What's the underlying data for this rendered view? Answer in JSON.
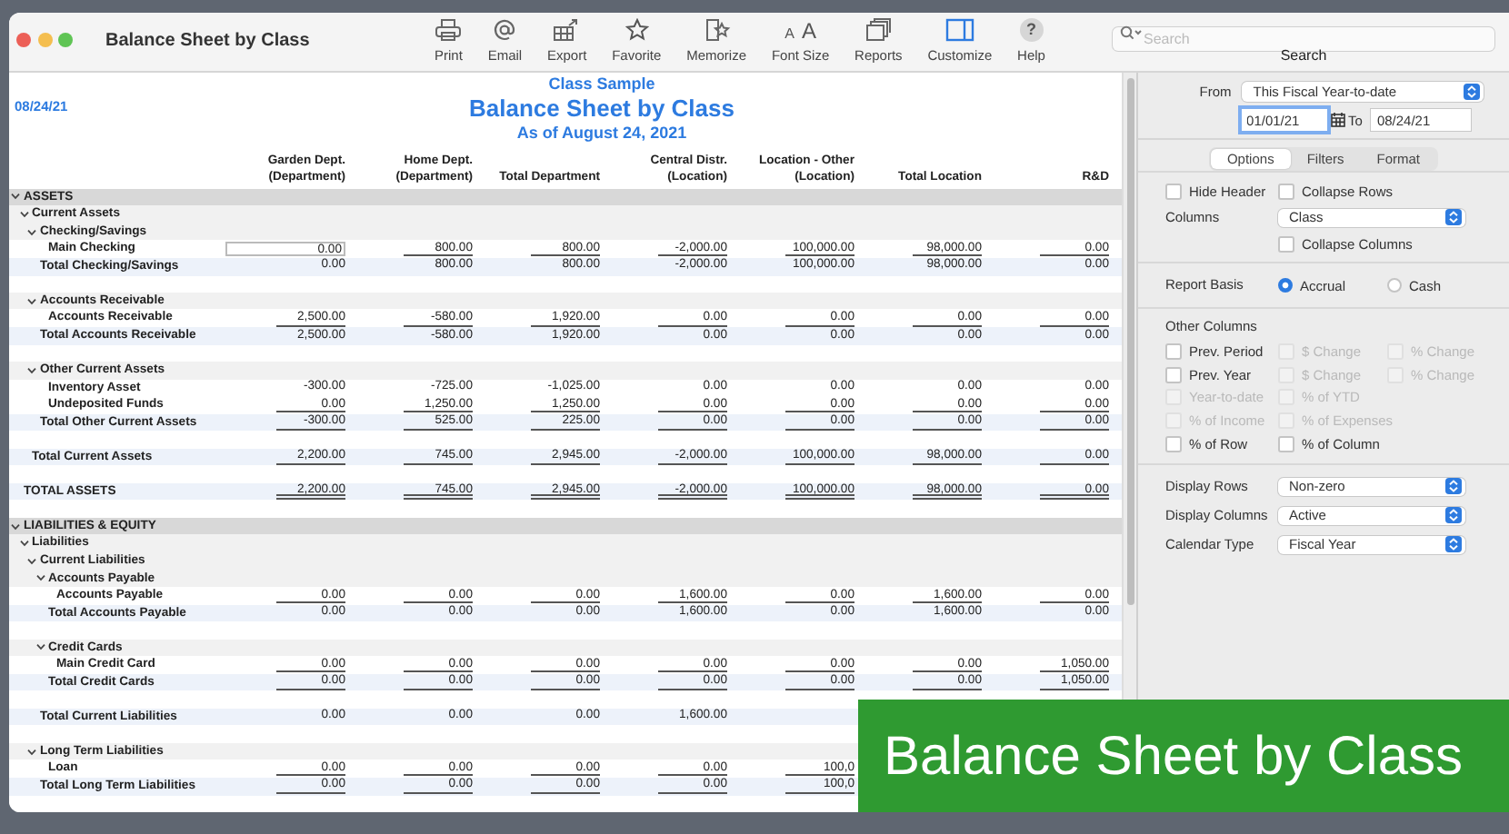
{
  "window": {
    "title": "Balance Sheet by Class"
  },
  "toolbar": [
    {
      "kind": "print",
      "label": "Print"
    },
    {
      "kind": "email",
      "label": "Email"
    },
    {
      "kind": "export",
      "label": "Export"
    },
    {
      "kind": "favorite",
      "label": "Favorite"
    },
    {
      "kind": "memorize",
      "label": "Memorize"
    },
    {
      "kind": "font_size",
      "label": "Font Size",
      "glyphs": [
        "A",
        "A"
      ]
    },
    {
      "kind": "reports",
      "label": "Reports"
    },
    {
      "kind": "customize",
      "label": "Customize"
    },
    {
      "kind": "help",
      "label": "Help",
      "glyphs": [
        "?"
      ]
    }
  ],
  "search": {
    "placeholder": "Search",
    "label": "Search"
  },
  "report": {
    "date": "08/24/21",
    "company": "Class Sample",
    "title": "Balance Sheet by Class",
    "subtitle": "As of August 24, 2021",
    "columns": [
      {
        "line1": "Garden Dept.",
        "line2": "(Department)"
      },
      {
        "line1": "Home Dept.",
        "line2": "(Department)"
      },
      {
        "line2": "Total Department"
      },
      {
        "line1": "Central Distr.",
        "line2": "(Location)"
      },
      {
        "line1": "Location - Other",
        "line2": "(Location)"
      },
      {
        "line2": "Total Location"
      },
      {
        "line2": "R&D"
      }
    ],
    "rows": [
      {
        "kind": "section",
        "label": "ASSETS",
        "expanded": true,
        "children": [
          {
            "kind": "group",
            "label": "Current Assets",
            "expanded": true,
            "children": [
              {
                "kind": "group",
                "label": "Checking/Savings",
                "expanded": true,
                "children": [
                  {
                    "kind": "row",
                    "label": "Main Checking",
                    "editing": true,
                    "underline": true,
                    "cells": [
                      "0.00",
                      "800.00",
                      "800.00",
                      "-2,000.00",
                      "100,000.00",
                      "98,000.00",
                      "0.00"
                    ]
                  }
                ],
                "total": {
                  "label": "Total Checking/Savings",
                  "underline": false,
                  "cells": [
                    "0.00",
                    "800.00",
                    "800.00",
                    "-2,000.00",
                    "100,000.00",
                    "98,000.00",
                    "0.00"
                  ]
                }
              },
              {
                "kind": "group",
                "label": "Accounts Receivable",
                "expanded": true,
                "children": [
                  {
                    "kind": "row",
                    "label": "Accounts Receivable",
                    "underline": true,
                    "cells": [
                      "2,500.00",
                      "-580.00",
                      "1,920.00",
                      "0.00",
                      "0.00",
                      "0.00",
                      "0.00"
                    ]
                  }
                ],
                "total": {
                  "label": "Total Accounts Receivable",
                  "underline": false,
                  "cells": [
                    "2,500.00",
                    "-580.00",
                    "1,920.00",
                    "0.00",
                    "0.00",
                    "0.00",
                    "0.00"
                  ]
                }
              },
              {
                "kind": "group",
                "label": "Other Current Assets",
                "expanded": true,
                "children": [
                  {
                    "kind": "row",
                    "label": "Inventory Asset",
                    "underline": false,
                    "cells": [
                      "-300.00",
                      "-725.00",
                      "-1,025.00",
                      "0.00",
                      "0.00",
                      "0.00",
                      "0.00"
                    ]
                  },
                  {
                    "kind": "row",
                    "label": "Undeposited Funds",
                    "underline": true,
                    "cells": [
                      "0.00",
                      "1,250.00",
                      "1,250.00",
                      "0.00",
                      "0.00",
                      "0.00",
                      "0.00"
                    ]
                  }
                ],
                "total": {
                  "label": "Total Other Current Assets",
                  "underline": true,
                  "cells": [
                    "-300.00",
                    "525.00",
                    "225.00",
                    "0.00",
                    "0.00",
                    "0.00",
                    "0.00"
                  ]
                }
              }
            ],
            "total": {
              "label": "Total Current Assets",
              "underline": true,
              "double_underline": false,
              "cells": [
                "2,200.00",
                "745.00",
                "2,945.00",
                "-2,000.00",
                "100,000.00",
                "98,000.00",
                "0.00"
              ]
            }
          }
        ],
        "total": {
          "label": "TOTAL ASSETS",
          "double_underline": true,
          "cells": [
            "2,200.00",
            "745.00",
            "2,945.00",
            "-2,000.00",
            "100,000.00",
            "98,000.00",
            "0.00"
          ]
        }
      },
      {
        "kind": "section",
        "label": "LIABILITIES & EQUITY",
        "expanded": true,
        "children": [
          {
            "kind": "group",
            "label": "Liabilities",
            "expanded": true,
            "children": [
              {
                "kind": "group",
                "label": "Current Liabilities",
                "expanded": true,
                "children": [
                  {
                    "kind": "group",
                    "label": "Accounts Payable",
                    "expanded": true,
                    "children": [
                      {
                        "kind": "row",
                        "label": "Accounts Payable",
                        "underline": true,
                        "cells": [
                          "0.00",
                          "0.00",
                          "0.00",
                          "1,600.00",
                          "0.00",
                          "1,600.00",
                          "0.00"
                        ]
                      }
                    ],
                    "total": {
                      "label": "Total Accounts Payable",
                      "underline": false,
                      "cells": [
                        "0.00",
                        "0.00",
                        "0.00",
                        "1,600.00",
                        "0.00",
                        "1,600.00",
                        "0.00"
                      ]
                    }
                  },
                  {
                    "kind": "group",
                    "label": "Credit Cards",
                    "expanded": true,
                    "children": [
                      {
                        "kind": "row",
                        "label": "Main Credit Card",
                        "underline": true,
                        "cells": [
                          "0.00",
                          "0.00",
                          "0.00",
                          "0.00",
                          "0.00",
                          "0.00",
                          "1,050.00"
                        ]
                      }
                    ],
                    "total": {
                      "label": "Total Credit Cards",
                      "underline": true,
                      "cells": [
                        "0.00",
                        "0.00",
                        "0.00",
                        "0.00",
                        "0.00",
                        "0.00",
                        "1,050.00"
                      ]
                    }
                  }
                ],
                "total": {
                  "label": "Total Current Liabilities",
                  "underline": false,
                  "cells": [
                    "0.00",
                    "0.00",
                    "0.00",
                    "1,600.00"
                  ]
                }
              },
              {
                "kind": "group",
                "label": "Long Term Liabilities",
                "expanded": true,
                "children": [
                  {
                    "kind": "row",
                    "label": "Loan",
                    "underline": true,
                    "cells": [
                      "0.00",
                      "0.00",
                      "0.00",
                      "0.00",
                      "100,0"
                    ]
                  }
                ],
                "total": {
                  "label": "Total Long Term Liabilities",
                  "underline": true,
                  "cells": [
                    "0.00",
                    "0.00",
                    "0.00",
                    "0.00",
                    "100,0"
                  ]
                }
              }
            ]
          }
        ]
      }
    ]
  },
  "sidebar": {
    "from": {
      "label": "From",
      "value": "This Fiscal Year-to-date"
    },
    "start_date": {
      "value": "01/01/21",
      "focused": true
    },
    "to_label": "To",
    "end_date": {
      "value": "08/24/21",
      "focused": false
    },
    "tabs": [
      {
        "label": "Options",
        "selected": true
      },
      {
        "label": "Filters",
        "selected": false
      },
      {
        "label": "Format",
        "selected": false
      }
    ],
    "option_groups": [
      [
        {
          "kind": "checks",
          "items": [
            {
              "label": "Hide Header",
              "checked": false,
              "disabled": false
            },
            {
              "label": "Collapse Rows",
              "checked": false,
              "disabled": false
            }
          ]
        },
        {
          "kind": "select",
          "label": "Columns",
          "value": "Class"
        },
        {
          "kind": "subcheck",
          "items": [
            {
              "label": "Collapse Columns",
              "checked": false,
              "disabled": false
            }
          ]
        }
      ],
      [
        {
          "kind": "radios",
          "label": "Report Basis",
          "items": [
            {
              "label": "Accrual",
              "selected": true
            },
            {
              "label": "Cash",
              "selected": false
            }
          ]
        }
      ],
      [
        {
          "kind": "heading",
          "label": "Other Columns"
        },
        {
          "kind": "checks",
          "items": [
            {
              "label": "Prev. Period",
              "checked": false,
              "disabled": false
            },
            {
              "label": "$ Change",
              "checked": false,
              "disabled": true
            },
            {
              "label": "% Change",
              "checked": false,
              "disabled": true
            }
          ]
        },
        {
          "kind": "checks",
          "items": [
            {
              "label": "Prev. Year",
              "checked": false,
              "disabled": false
            },
            {
              "label": "$ Change",
              "checked": false,
              "disabled": true
            },
            {
              "label": "% Change",
              "checked": false,
              "disabled": true
            }
          ]
        },
        {
          "kind": "checks",
          "items": [
            {
              "label": "Year-to-date",
              "checked": false,
              "disabled": true
            },
            {
              "label": "% of YTD",
              "checked": false,
              "disabled": true
            }
          ]
        },
        {
          "kind": "checks",
          "items": [
            {
              "label": "% of Income",
              "checked": false,
              "disabled": true
            },
            {
              "label": "% of Expenses",
              "checked": false,
              "disabled": true
            }
          ]
        },
        {
          "kind": "checks",
          "items": [
            {
              "label": "% of Row",
              "checked": false,
              "disabled": false
            },
            {
              "label": "% of Column",
              "checked": false,
              "disabled": false
            }
          ]
        }
      ],
      [
        {
          "kind": "select",
          "label": "Display Rows",
          "value": "Non-zero"
        },
        {
          "kind": "select",
          "label": "Display Columns",
          "value": "Active"
        },
        {
          "kind": "select",
          "label": "Calendar Type",
          "value": "Fiscal Year"
        }
      ]
    ]
  },
  "caption": {
    "text": "Balance Sheet by Class"
  }
}
